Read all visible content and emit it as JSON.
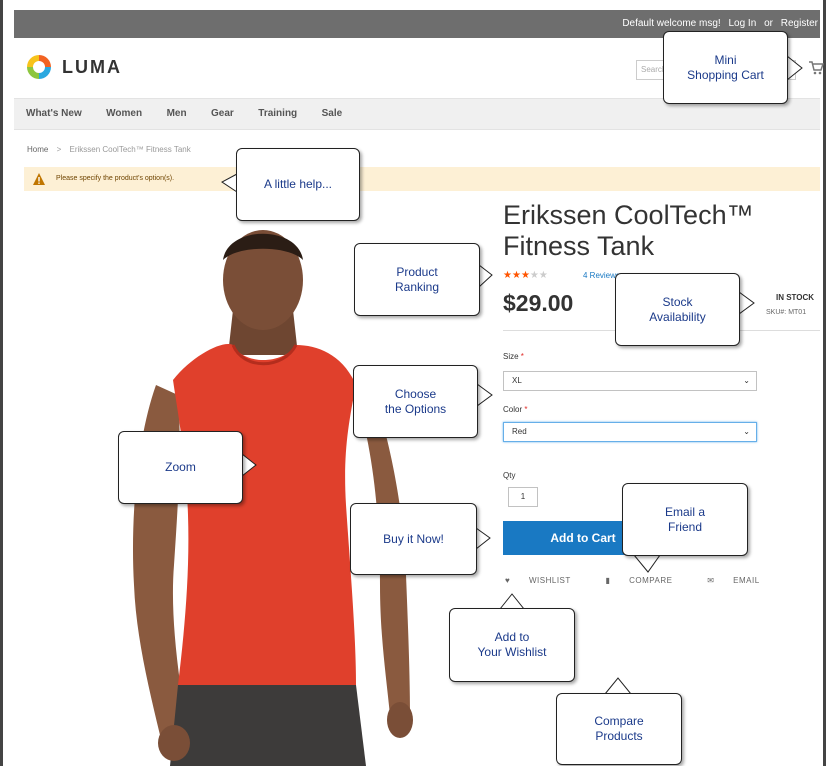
{
  "topbar": {
    "welcome": "Default welcome msg!",
    "login": "Log In",
    "or": "or",
    "register": "Register"
  },
  "header": {
    "brand": "LUMA",
    "search_placeholder": "Search",
    "cart_icon": "cart-icon"
  },
  "nav": {
    "items": [
      "What's New",
      "Women",
      "Men",
      "Gear",
      "Training",
      "Sale"
    ]
  },
  "breadcrumb": {
    "home": "Home",
    "separator": ">",
    "current": "Erikssen CoolTech™ Fitness Tank"
  },
  "alert": {
    "icon": "warning-icon",
    "message": "Please specify the product's option(s)."
  },
  "product": {
    "title_line1": "Erikssen CoolTech™",
    "title_line2": "Fitness Tank",
    "rating": {
      "value": 3,
      "max": 5
    },
    "reviews": "4 Reviews",
    "price": "$29.00",
    "stock": "IN STOCK",
    "sku_label": "SKU#:",
    "sku": "MT01",
    "size_label": "Size",
    "size_value": "XL",
    "color_label": "Color",
    "color_value": "Red",
    "qty_label": "Qty",
    "qty_value": "1",
    "required_mark": "*",
    "add_to_cart": "Add to Cart",
    "wishlist": "WISHLIST",
    "compare": "COMPARE",
    "email": "EMAIL"
  },
  "colors": {
    "accent": "#1979c3",
    "star": "#ff5501",
    "alert_bg": "#fdf0d5",
    "shirt": "#e0402c",
    "callout_text": "#1b3a8a"
  },
  "callouts": {
    "mini_cart": [
      "Mini",
      "Shopping Cart"
    ],
    "help": [
      "A little help..."
    ],
    "ranking": [
      "Product",
      "Ranking"
    ],
    "stock": [
      "Stock",
      "Availability"
    ],
    "options": [
      "Choose",
      "the Options"
    ],
    "zoom": [
      "Zoom"
    ],
    "buy": [
      "Buy it Now!"
    ],
    "email": [
      "Email a",
      "Friend"
    ],
    "wishlist": [
      "Add to",
      "Your Wishlist"
    ],
    "compare": [
      "Compare",
      "Products"
    ]
  }
}
